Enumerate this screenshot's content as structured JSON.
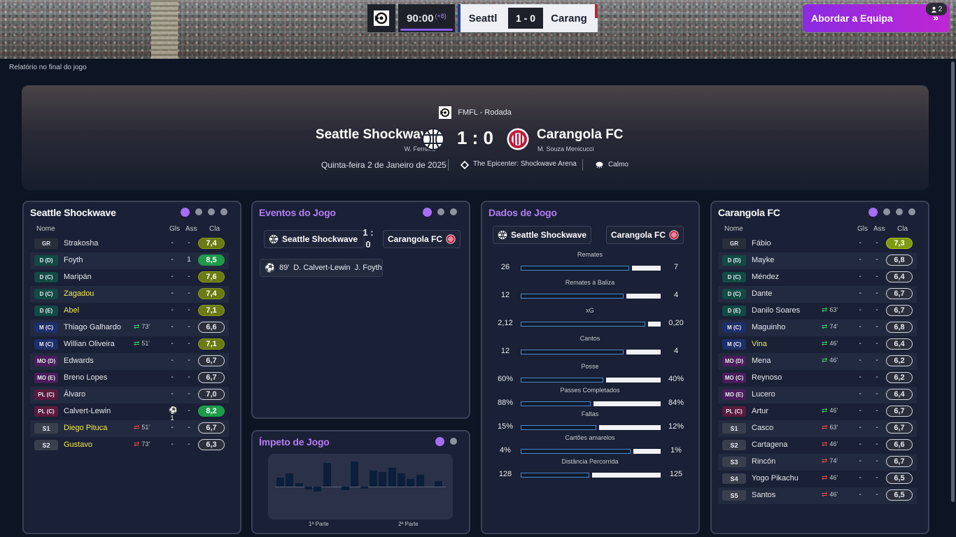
{
  "scorebug": {
    "time": "90:00",
    "added": "(+8)",
    "home_short": "Seattl",
    "score": "1 - 0",
    "away_short": "Carang"
  },
  "team_talk": {
    "label": "Abordar a Equipa",
    "badge_count": "2"
  },
  "breadcrumb": "Relatório no final do jogo",
  "match": {
    "competition": "FMFL - Rodada",
    "home_team": "Seattle Shockwave",
    "home_manager": "W. Ferreira",
    "away_team": "Carangola FC",
    "away_manager": "M. Souza Menicucci",
    "score": "1 : 0",
    "date": "Quinta-feira 2 de Janeiro de 2025",
    "venue": "The Epicenter: Shockwave Arena",
    "weather": "Calmo"
  },
  "columns": {
    "name": "Nome",
    "goals": "Gls",
    "assists": "Ass",
    "rating": "Cla"
  },
  "home_panel": {
    "title": "Seattle Shockwave",
    "players": [
      {
        "pos": "GR",
        "cls": "gk",
        "name": "Strakosha",
        "gls": "-",
        "ass": "-",
        "rating": "7,4",
        "rc": "olive"
      },
      {
        "pos": "D (D)",
        "cls": "df",
        "name": "Foyth",
        "gls": "-",
        "ass": "1",
        "rating": "8,5",
        "rc": "green"
      },
      {
        "pos": "D (C)",
        "cls": "df",
        "name": "Maripán",
        "gls": "-",
        "ass": "-",
        "rating": "7,6",
        "rc": "olive"
      },
      {
        "pos": "D (C)",
        "cls": "df",
        "name": "Zagadou",
        "gls": "-",
        "ass": "-",
        "rating": "7,4",
        "rc": "olive",
        "hl": true
      },
      {
        "pos": "D (E)",
        "cls": "df",
        "name": "Abel",
        "gls": "-",
        "ass": "-",
        "rating": "7,1",
        "rc": "olive",
        "hl": true
      },
      {
        "pos": "M (C)",
        "cls": "mf",
        "name": "Thiago Galhardo",
        "swap": "73'",
        "dir": "in",
        "gls": "-",
        "ass": "-",
        "rating": "6,6",
        "rc": ""
      },
      {
        "pos": "M (C)",
        "cls": "mf",
        "name": "Willian Oliveira",
        "swap": "51'",
        "dir": "in",
        "gls": "-",
        "ass": "-",
        "rating": "7,1",
        "rc": "olive"
      },
      {
        "pos": "MO (D)",
        "cls": "am",
        "name": "Edwards",
        "gls": "-",
        "ass": "-",
        "rating": "6,7",
        "rc": ""
      },
      {
        "pos": "MO (E)",
        "cls": "am",
        "name": "Breno Lopes",
        "gls": "-",
        "ass": "-",
        "rating": "6,7",
        "rc": ""
      },
      {
        "pos": "PL (C)",
        "cls": "fw",
        "name": "Álvaro",
        "gls": "-",
        "ass": "-",
        "rating": "7,0",
        "rc": ""
      },
      {
        "pos": "PL (C)",
        "cls": "fw",
        "name": "Calvert-Lewin",
        "gls": "⚽1",
        "ass": "-",
        "rating": "8,2",
        "rc": "green"
      },
      {
        "pos": "S1",
        "cls": "sb",
        "name": "Diego Pituca",
        "swap": "51'",
        "dir": "out",
        "gls": "-",
        "ass": "-",
        "rating": "6,7",
        "rc": "",
        "hl": true
      },
      {
        "pos": "S2",
        "cls": "sb",
        "name": "Gustavo",
        "swap": "73'",
        "dir": "out",
        "gls": "-",
        "ass": "-",
        "rating": "6,3",
        "rc": "",
        "hl": true
      }
    ]
  },
  "away_panel": {
    "title": "Carangola FC",
    "players": [
      {
        "pos": "GR",
        "cls": "gk",
        "name": "Fábio",
        "gls": "-",
        "ass": "-",
        "rating": "7,3",
        "rc": "lime"
      },
      {
        "pos": "D (D)",
        "cls": "df",
        "name": "Mayke",
        "gls": "-",
        "ass": "-",
        "rating": "6,8",
        "rc": ""
      },
      {
        "pos": "D (C)",
        "cls": "df",
        "name": "Méndez",
        "gls": "-",
        "ass": "-",
        "rating": "6,4",
        "rc": ""
      },
      {
        "pos": "D (C)",
        "cls": "df",
        "name": "Dante",
        "gls": "-",
        "ass": "-",
        "rating": "6,7",
        "rc": ""
      },
      {
        "pos": "D (E)",
        "cls": "df",
        "name": "Danilo Soares",
        "swap": "63'",
        "dir": "in",
        "gls": "-",
        "ass": "-",
        "rating": "6,7",
        "rc": ""
      },
      {
        "pos": "M (C)",
        "cls": "mf",
        "name": "Maguinho",
        "swap": "74'",
        "dir": "in",
        "gls": "-",
        "ass": "-",
        "rating": "6,8",
        "rc": ""
      },
      {
        "pos": "M (C)",
        "cls": "mf",
        "name": "Vina",
        "swap": "46'",
        "dir": "in",
        "gls": "-",
        "ass": "-",
        "rating": "6,4",
        "rc": "",
        "hl": true
      },
      {
        "pos": "MO (D)",
        "cls": "am",
        "name": "Mena",
        "swap": "46'",
        "dir": "in",
        "gls": "-",
        "ass": "-",
        "rating": "6,2",
        "rc": ""
      },
      {
        "pos": "MO (C)",
        "cls": "am",
        "name": "Reynoso",
        "gls": "-",
        "ass": "-",
        "rating": "6,2",
        "rc": ""
      },
      {
        "pos": "MO (E)",
        "cls": "am",
        "name": "Lucero",
        "gls": "-",
        "ass": "-",
        "rating": "6,4",
        "rc": ""
      },
      {
        "pos": "PL (C)",
        "cls": "fw",
        "name": "Artur",
        "swap": "46'",
        "dir": "in",
        "gls": "-",
        "ass": "-",
        "rating": "6,7",
        "rc": ""
      },
      {
        "pos": "S1",
        "cls": "sb",
        "name": "Casco",
        "swap": "63'",
        "dir": "out",
        "gls": "-",
        "ass": "-",
        "rating": "6,7",
        "rc": ""
      },
      {
        "pos": "S2",
        "cls": "sb",
        "name": "Cartagena",
        "swap": "46'",
        "dir": "out",
        "gls": "-",
        "ass": "-",
        "rating": "6,6",
        "rc": ""
      },
      {
        "pos": "S3",
        "cls": "sb",
        "name": "Rincón",
        "swap": "74'",
        "dir": "out",
        "gls": "-",
        "ass": "-",
        "rating": "6,7",
        "rc": ""
      },
      {
        "pos": "S4",
        "cls": "sb",
        "name": "Yogo Pikachu",
        "swap": "46'",
        "dir": "out",
        "gls": "-",
        "ass": "-",
        "rating": "6,5",
        "rc": ""
      },
      {
        "pos": "S5",
        "cls": "sb",
        "name": "Santos",
        "swap": "46'",
        "dir": "out",
        "gls": "-",
        "ass": "-",
        "rating": "6,5",
        "rc": ""
      }
    ]
  },
  "events_panel": {
    "title": "Eventos do Jogo",
    "home_label": "Seattle Shockwave",
    "away_label": "Carangola FC",
    "score": "1 : 0",
    "events": [
      {
        "minute": "89'",
        "scorer": "D. Calvert-Lewin",
        "assist": "J. Foyth"
      }
    ]
  },
  "momentum_panel": {
    "title": "Ímpeto de Jogo",
    "first_half": "1ª Parte",
    "second_half": "2ª Parte",
    "values": [
      0.35,
      0.5,
      0.12,
      -0.1,
      -0.18,
      0.9,
      0,
      -0.12,
      0.95,
      -0.08,
      0.6,
      0.55,
      0.72,
      0.5,
      0.3,
      0.45,
      0,
      0.22
    ]
  },
  "stats_panel": {
    "title": "Dados de Jogo",
    "home_label": "Seattle Shockwave",
    "away_label": "Carangola FC",
    "stats": [
      {
        "label": "Remates",
        "home": "26",
        "away": "7",
        "hf": 0.79
      },
      {
        "label": "Remates à Baliza",
        "home": "12",
        "away": "4",
        "hf": 0.75
      },
      {
        "label": "xG",
        "home": "2,12",
        "away": "0,20",
        "hf": 0.91
      },
      {
        "label": "Cantos",
        "home": "12",
        "away": "4",
        "hf": 0.75
      },
      {
        "label": "Posse",
        "home": "60%",
        "away": "40%",
        "hf": 0.6
      },
      {
        "label": "Passes Completados",
        "home": "88%",
        "away": "84%",
        "hf": 0.51
      },
      {
        "label": "Faltas",
        "home": "15%",
        "away": "12%",
        "hf": 0.55
      },
      {
        "label": "Cartões amarelos",
        "home": "4%",
        "away": "1%",
        "hf": 0.8
      },
      {
        "label": "Distância Percorrida",
        "home": "128",
        "away": "125",
        "hf": 0.5
      }
    ]
  },
  "colors": {
    "accent": "#a66df7",
    "rating_green": "#1f9a4a",
    "rating_olive": "#6b7a12",
    "sub_highlight": "#f2ea50"
  }
}
